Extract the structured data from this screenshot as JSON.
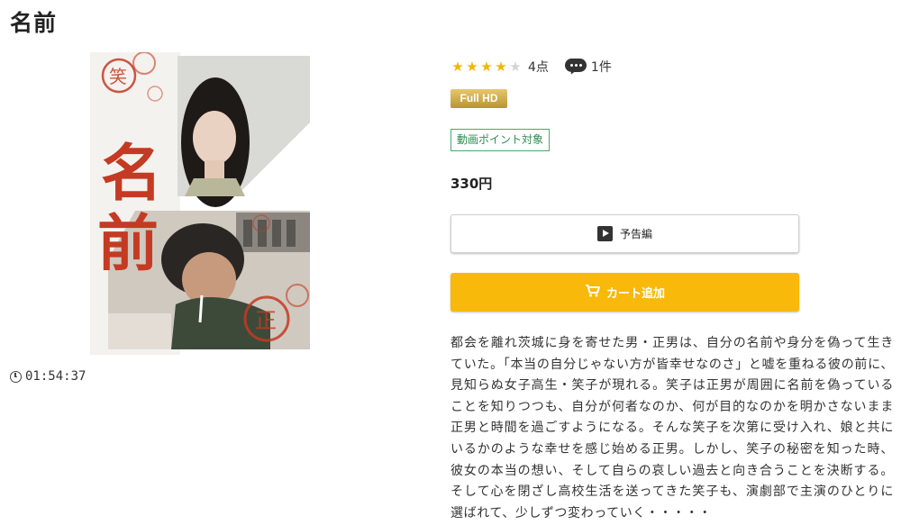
{
  "title": "名前",
  "poster": {
    "title_chars": [
      "名",
      "前"
    ],
    "stamp_text_top": "笑",
    "stamp_text_bottom": "正"
  },
  "duration": "01:54:37",
  "rating": {
    "stars": 4,
    "max": 5,
    "score_label": "4点",
    "comment_count": "1件"
  },
  "badges": {
    "full_hd": "Full HD",
    "point": "動画ポイント対象"
  },
  "price": "330円",
  "buttons": {
    "trailer": "予告編",
    "cart": "カート追加"
  },
  "synopsis": "都会を離れ茨城に身を寄せた男・正男は、自分の名前や身分を偽って生きていた。「本当の自分じゃない方が皆幸せなのさ」と嘘を重ねる彼の前に、見知らぬ女子高生・笑子が現れる。笑子は正男が周囲に名前を偽っていることを知りつつも、自分が何者なのか、何が目的なのかを明かさないまま正男と時間を過ごすようになる。そんな笑子を次第に受け入れ、娘と共にいるかのような幸せを感じ始める正男。しかし、笑子の秘密を知った時、彼女の本当の想い、そして自らの哀しい過去と向き合うことを決断する。そして心を閉ざし高校生活を送ってきた笑子も、演劇部で主演のひとりに選ばれて、少しずつ変わっていく・・・・・",
  "colors": {
    "star_on": "#f1b600",
    "star_off": "#d4d4d4",
    "cart_bg": "#f8b90b",
    "hd_gold": "#c9a440",
    "point_green": "#2e8b50",
    "poster_red": "#c43a22"
  }
}
